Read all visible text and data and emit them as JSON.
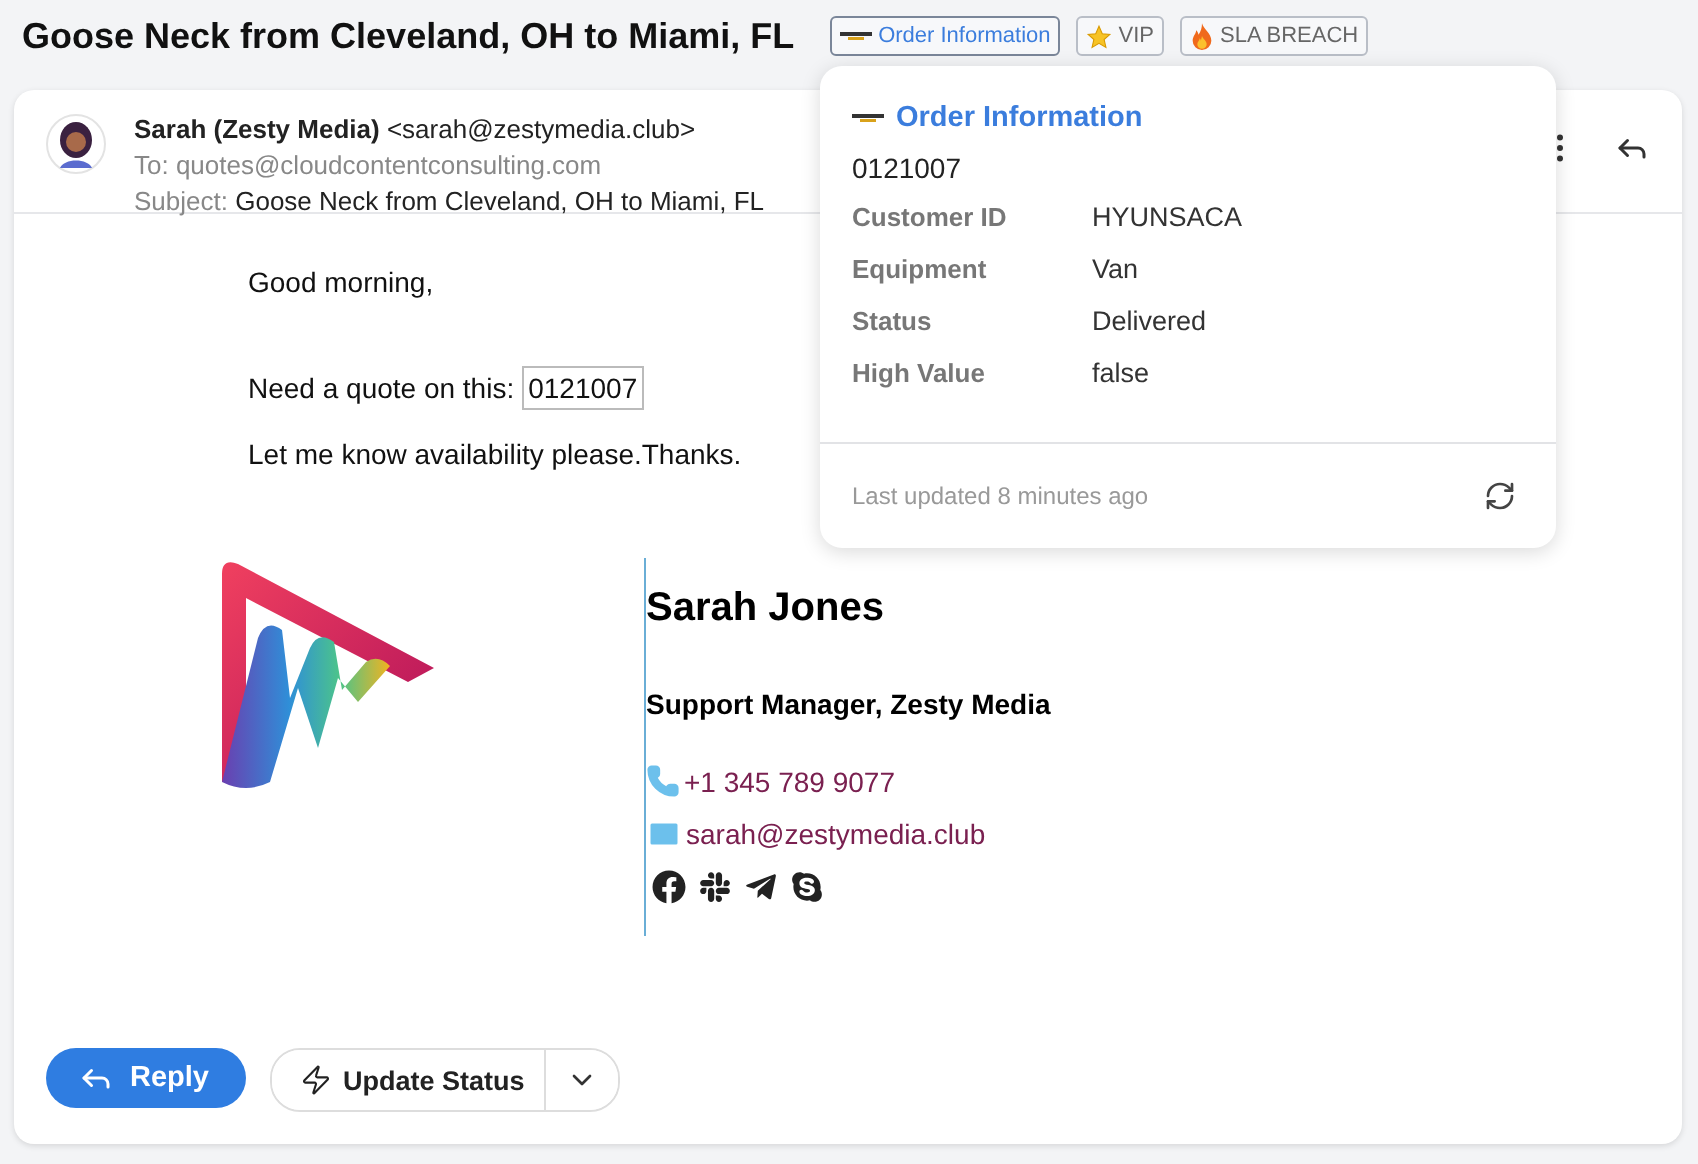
{
  "title": "Goose Neck from Cleveland, OH to Miami, FL",
  "tags": [
    {
      "kind": "order",
      "label": "Order Information"
    },
    {
      "kind": "star",
      "label": "VIP"
    },
    {
      "kind": "fire",
      "label": "SLA BREACH"
    }
  ],
  "email": {
    "sender_name": "Sarah (Zesty Media)",
    "sender_address": "<sarah@zestymedia.club>",
    "to": "To: quotes@cloudcontentconsulting.com",
    "subject_label": "Subject:",
    "subject": "Goose Neck from Cleveland, OH to Miami, FL",
    "body": [
      {
        "text": "Good morning,"
      },
      {
        "text": "Need a quote on this:",
        "code": "0121007"
      },
      {
        "text": "Let me know availability please.Thanks."
      }
    ]
  },
  "signature": {
    "name": "Sarah Jones",
    "role": "Support Manager, Zesty Media",
    "phone": "+1 345 789 9077",
    "email": "sarah@zestymedia.club"
  },
  "actions": {
    "reply": "Reply",
    "update_status": "Update Status"
  },
  "popover": {
    "title": "Order Information",
    "order_id": "0121007",
    "fields": [
      {
        "label": "Customer ID",
        "value": "HYUNSACA"
      },
      {
        "label": "Equipment",
        "value": "Van"
      },
      {
        "label": "Status",
        "value": "Delivered"
      },
      {
        "label": "High Value",
        "value": "false"
      }
    ],
    "footer": "Last updated 8 minutes ago"
  }
}
